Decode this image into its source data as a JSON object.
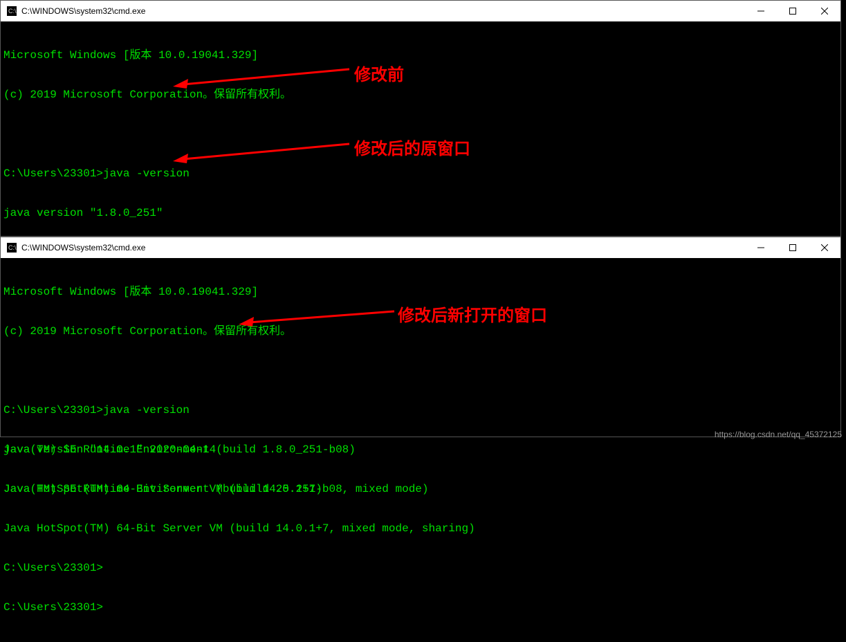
{
  "window1": {
    "title": "C:\\WINDOWS\\system32\\cmd.exe",
    "lines": [
      "Microsoft Windows [版本 10.0.19041.329]",
      "(c) 2019 Microsoft Corporation。保留所有权利。",
      "",
      "C:\\Users\\23301>java -version",
      "java version \"1.8.0_251\"",
      "Java(TM) SE Runtime Environment (build 1.8.0_251-b08)",
      "Java HotSpot(TM) 64-Bit Server VM (build 25.251-b08, mixed mode)",
      "",
      "C:\\Users\\23301>java -version",
      "java version \"1.8.0_251\"",
      "Java(TM) SE Runtime Environment (build 1.8.0_251-b08)",
      "Java HotSpot(TM) 64-Bit Server VM (build 25.251-b08, mixed mode)",
      "",
      "C:\\Users\\23301>"
    ]
  },
  "window2": {
    "title": "C:\\WINDOWS\\system32\\cmd.exe",
    "lines": [
      "Microsoft Windows [版本 10.0.19041.329]",
      "(c) 2019 Microsoft Corporation。保留所有权利。",
      "",
      "C:\\Users\\23301>java -version",
      "java version \"14.0.1\" 2020-04-14",
      "Java(TM) SE Runtime Environment (build 14.0.1+7)",
      "Java HotSpot(TM) 64-Bit Server VM (build 14.0.1+7, mixed mode, sharing)",
      "",
      "C:\\Users\\23301>"
    ]
  },
  "annotations": {
    "label1": "修改前",
    "label2": "修改后的原窗口",
    "label3": "修改后新打开的窗口"
  },
  "watermark": "https://blog.csdn.net/qq_45372125"
}
